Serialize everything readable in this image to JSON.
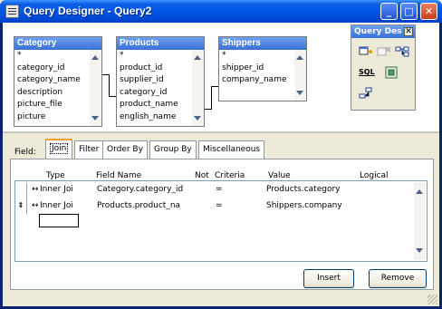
{
  "window": {
    "title": "Query Designer - Query2",
    "controls": {
      "minimize": "_",
      "maximize": "□",
      "close": "✕"
    }
  },
  "diagram": {
    "tables": [
      {
        "name": "Category",
        "fields": [
          "*",
          "category_id",
          "category_name",
          "description",
          "picture_file",
          "picture"
        ]
      },
      {
        "name": "Products",
        "fields": [
          "*",
          "product_id",
          "supplier_id",
          "category_id",
          "product_name",
          "english_name"
        ]
      },
      {
        "name": "Shippers",
        "fields": [
          "*",
          "shipper_id",
          "company_name"
        ]
      }
    ]
  },
  "palette": {
    "title": "Query Des",
    "close": "✕",
    "icons": [
      "add-table-icon",
      "remove-table-icon",
      "joins-icon",
      "sql-icon",
      "properties-icon",
      "relations-icon"
    ],
    "sql_label": "SQL"
  },
  "bottom": {
    "field_label": "Field:",
    "tabs": [
      "Join",
      "Filter",
      "Order By",
      "Group By",
      "Miscellaneous"
    ],
    "active_tab": "Join",
    "columns": [
      "Type",
      "Field Name",
      "Not",
      "Criteria",
      "Value",
      "Logical"
    ],
    "rows": [
      {
        "selector": "",
        "type": "Inner Joi",
        "field_name": "Category.category_id",
        "not": "",
        "criteria": "=",
        "value": "Products.category",
        "logical": ""
      },
      {
        "selector": "⇕",
        "type": "Inner Joi",
        "field_name": "Products.product_na",
        "not": "",
        "criteria": "=",
        "value": "Shippers.company",
        "logical": ""
      }
    ],
    "insert_label": "Insert",
    "remove_label": "Remove"
  }
}
